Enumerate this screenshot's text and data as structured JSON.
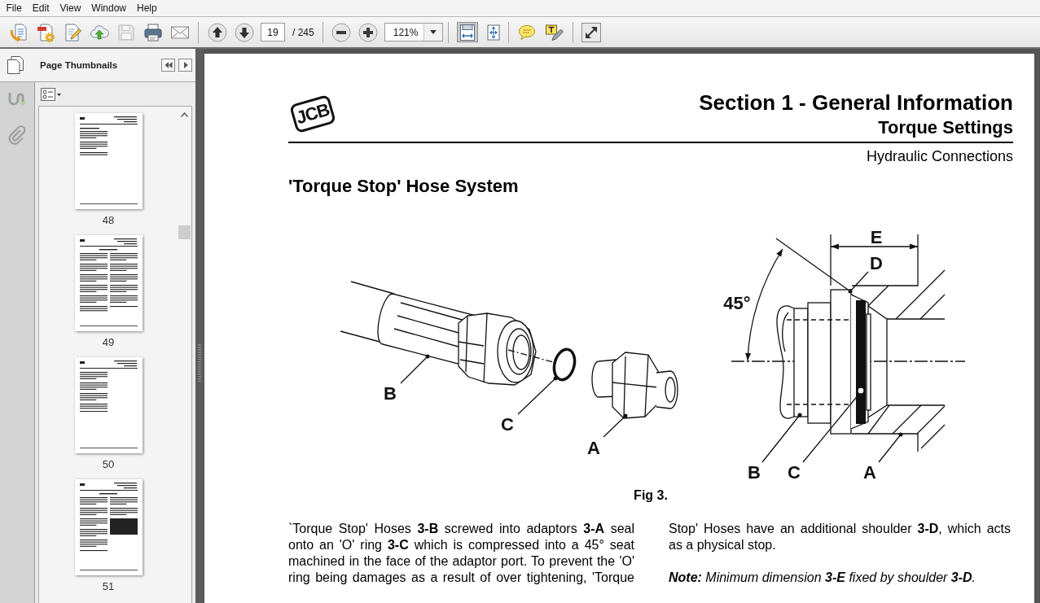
{
  "menu": [
    "File",
    "Edit",
    "View",
    "Window",
    "Help"
  ],
  "toolbar": {
    "save_disabled": true,
    "page_field": "19",
    "page_total": "/ 245",
    "zoom_field": "121%",
    "view_modes": [
      {
        "selected": true
      },
      {
        "selected": false
      }
    ]
  },
  "sidebar": {
    "title": "Page Thumbnails",
    "thumbnails": [
      {
        "label": "48",
        "selected": false
      },
      {
        "label": "49",
        "selected": false
      },
      {
        "label": "50",
        "selected": false
      },
      {
        "label": "51",
        "selected": false
      }
    ]
  },
  "document": {
    "logo": "JCB",
    "section_title": "Section 1 - General Information",
    "chapter_title": "Torque Settings",
    "topic": "Hydraulic Connections",
    "heading": "'Torque Stop' Hose System",
    "figure": {
      "left_labels": [
        "B",
        "C",
        "A"
      ],
      "right_labels": [
        "45°",
        "E",
        "D",
        "B",
        "C",
        "A"
      ],
      "caption": "Fig 3."
    },
    "columns": [
      [
        {
          "kind": "text",
          "text": "`Torque Stop' Hoses **3-B** screwed into adaptors **3-A** seal onto an 'O' ring **3-C** which is compressed into a 45° seat machined in the face of the adaptor port. To prevent the 'O' ring being damages as a result of over tightening, 'Torque"
        }
      ],
      [
        {
          "kind": "text",
          "text": "Stop' Hoses have an additional shoulder **3-D**, which acts as a physical stop."
        },
        {
          "kind": "note",
          "text": "**Note:** Minimum dimension **3-E** fixed by shoulder **3-D**."
        }
      ]
    ]
  }
}
